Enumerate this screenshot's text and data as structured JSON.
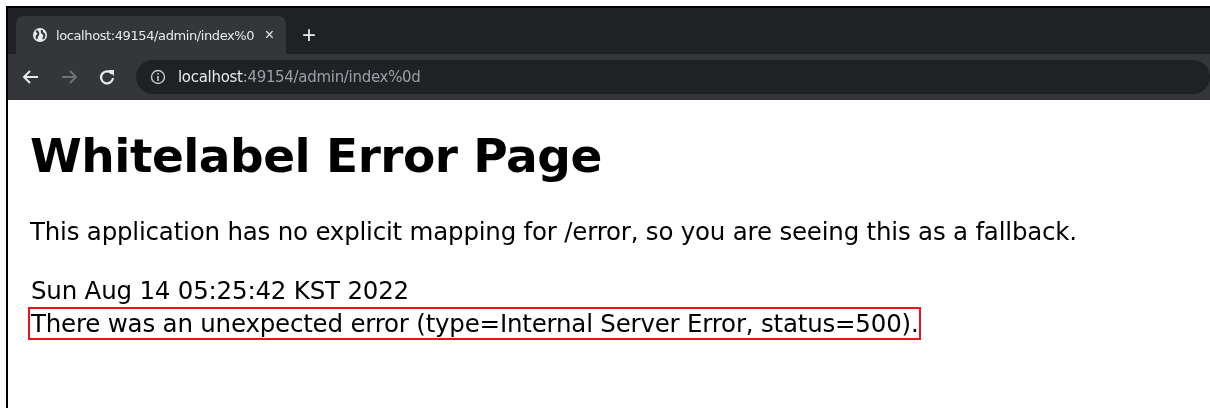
{
  "browser": {
    "tab": {
      "title": "localhost:49154/admin/index%0",
      "close": "×",
      "selected": true
    },
    "new_tab": "+",
    "address": "**localhost**:49154/admin/index%0d",
    "back_enabled": true,
    "forward_enabled": false
  },
  "page": {
    "heading": "Whitelabel Error Page",
    "message": "This application has no explicit mapping for /error, so you are seeing this as a fallback.",
    "lines": [
      {
        "text": "Sun Aug 14 05:25:42 KST 2022",
        "highlighted": false
      },
      {
        "text": "There was an unexpected error (type=Internal Server Error, status=500).",
        "highlighted": true
      }
    ]
  }
}
